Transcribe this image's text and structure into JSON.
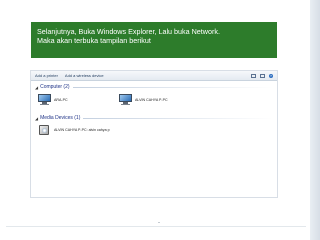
{
  "caption": {
    "line1": "Selanjutnya, Buka Windows Explorer, Lalu buka Network.",
    "line2": "Maka akan terbuka tampilan berikut"
  },
  "explorer": {
    "toolbar": {
      "add_printer": "Add a printer",
      "add_wireless": "Add a wireless device"
    },
    "groups": [
      {
        "label": "Computer (2)",
        "items": [
          {
            "label": "ARA-PC",
            "icon": "computer-icon"
          },
          {
            "label": "ALVIN CAHYA P-PC",
            "icon": "computer-icon"
          }
        ]
      },
      {
        "label": "Media Devices (1)",
        "items": [
          {
            "label": "ALVIN CAHYA P-PC: alvin cahya p",
            "icon": "media-device-icon"
          }
        ]
      }
    ]
  },
  "colors": {
    "caption_background": "#2d7c2b",
    "group_header_text": "#1e3287"
  }
}
